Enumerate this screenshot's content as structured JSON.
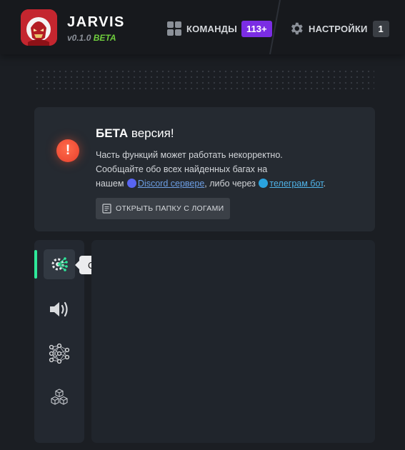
{
  "app": {
    "title": "JARVIS",
    "version": "v0.1.0",
    "channel": "BETA"
  },
  "nav": {
    "commands_label": "КОМАНДЫ",
    "commands_count": "113+",
    "settings_label": "НАСТРОЙКИ",
    "settings_count": "1"
  },
  "beta_notice": {
    "title_bold": "БЕТА",
    "title_rest": "версия!",
    "line1": "Часть функций может работать некорректно.",
    "line2": "Сообщайте обо всех найденных багах на",
    "line3_prefix": "нашем",
    "discord_link": "Discord сервере",
    "middle": ", либо через",
    "telegram_link": "телеграм бот",
    "end": ".",
    "open_logs_button": "ОТКРЫТЬ ПАПКУ С ЛОГАМИ"
  },
  "sidebar": {
    "items": [
      {
        "icon": "gear-network-icon",
        "tooltip": "Общее",
        "active": true
      },
      {
        "icon": "speaker-icon"
      },
      {
        "icon": "neural-network-icon"
      },
      {
        "icon": "cubes-icon"
      }
    ]
  },
  "colors": {
    "accent_green": "#2ee89a",
    "badge_purple": "#7b2de4",
    "beta_green": "#6fce3d",
    "warning_red": "#e8402d",
    "link_blue": "#6c9ee3"
  }
}
